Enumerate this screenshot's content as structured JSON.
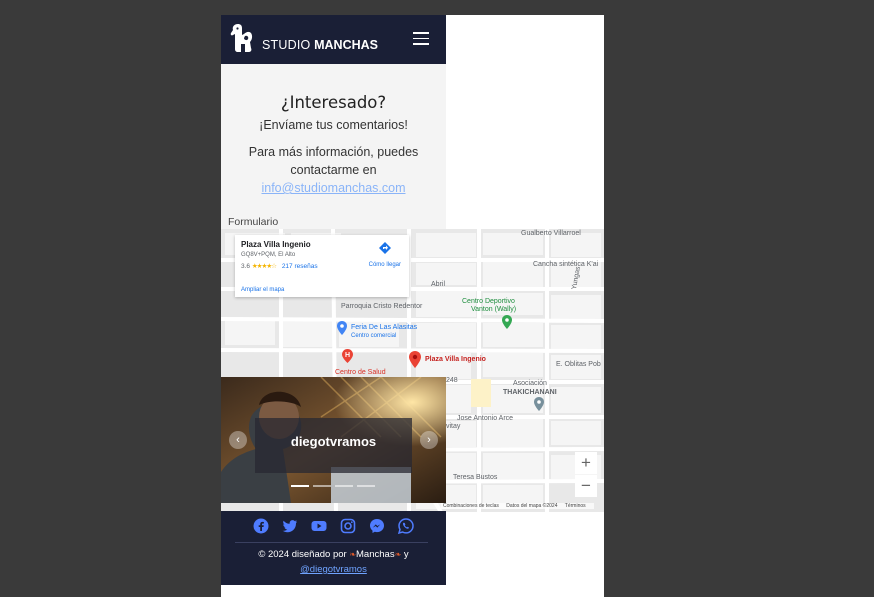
{
  "header": {
    "brand_light": "STUDIO ",
    "brand_bold": "MANCHAS"
  },
  "contact": {
    "title": "¿Interesado?",
    "subtitle": "¡Envíame tus comentarios!",
    "info": "Para más información, puedes contactarme en",
    "email": "info@studiomanchas.com"
  },
  "form_label": "Formulario",
  "map": {
    "card": {
      "name": "Plaza Villa Ingenio",
      "address": "GQ8V+PQM, El Alto",
      "rating": "3.6",
      "stars": "★★★★☆",
      "reviews": "217 reseñas",
      "directions": "Cómo llegar",
      "enlarge": "Ampliar el mapa"
    },
    "labels": {
      "street_top": "Gualberto Villarroel",
      "cancha": "Cancha sintética K'ai",
      "abril": "Abril",
      "parroquia": "Parroquia Cristo Redentor",
      "feria": "Feria De Las Alasitas",
      "centro_comercial": "Centro comercial",
      "centro_deportivo": "Centro Deportivo",
      "vanton": "Vanton (Wally)",
      "salud": "Centro de Salud",
      "plaza": "Plaza Villa Ingenio",
      "oblitas": "E. Oblitas Pob",
      "asociacion": "Asociación",
      "thakichanani": "THAKICHANANI",
      "jose": "Jose Antonio Arce",
      "teresa": "Teresa Bustos",
      "yungas": "Yungas",
      "n248": "248",
      "vitay": "vitay"
    },
    "zoom_in": "+",
    "zoom_out": "−",
    "footer": {
      "shortcuts": "Combinaciones de teclas",
      "data": "Datos del mapa ©2024",
      "terms": "Términos"
    }
  },
  "carousel": {
    "caption": "diegotvramos",
    "prev": "‹",
    "next": "›",
    "slides": 4,
    "active_slide": 1
  },
  "footer": {
    "social": [
      "facebook",
      "twitter",
      "youtube",
      "instagram",
      "messenger",
      "whatsapp"
    ],
    "credit_prefix": "© 2024 diseñado por",
    "credit_brand": "Manchas",
    "credit_and": "y",
    "credit_link": "@diegotvramos"
  },
  "colors": {
    "header_bg": "#1a1f36",
    "section_bg": "#f4f4f4",
    "link": "#8ab4f8",
    "footer_link": "#6fa3ff"
  }
}
